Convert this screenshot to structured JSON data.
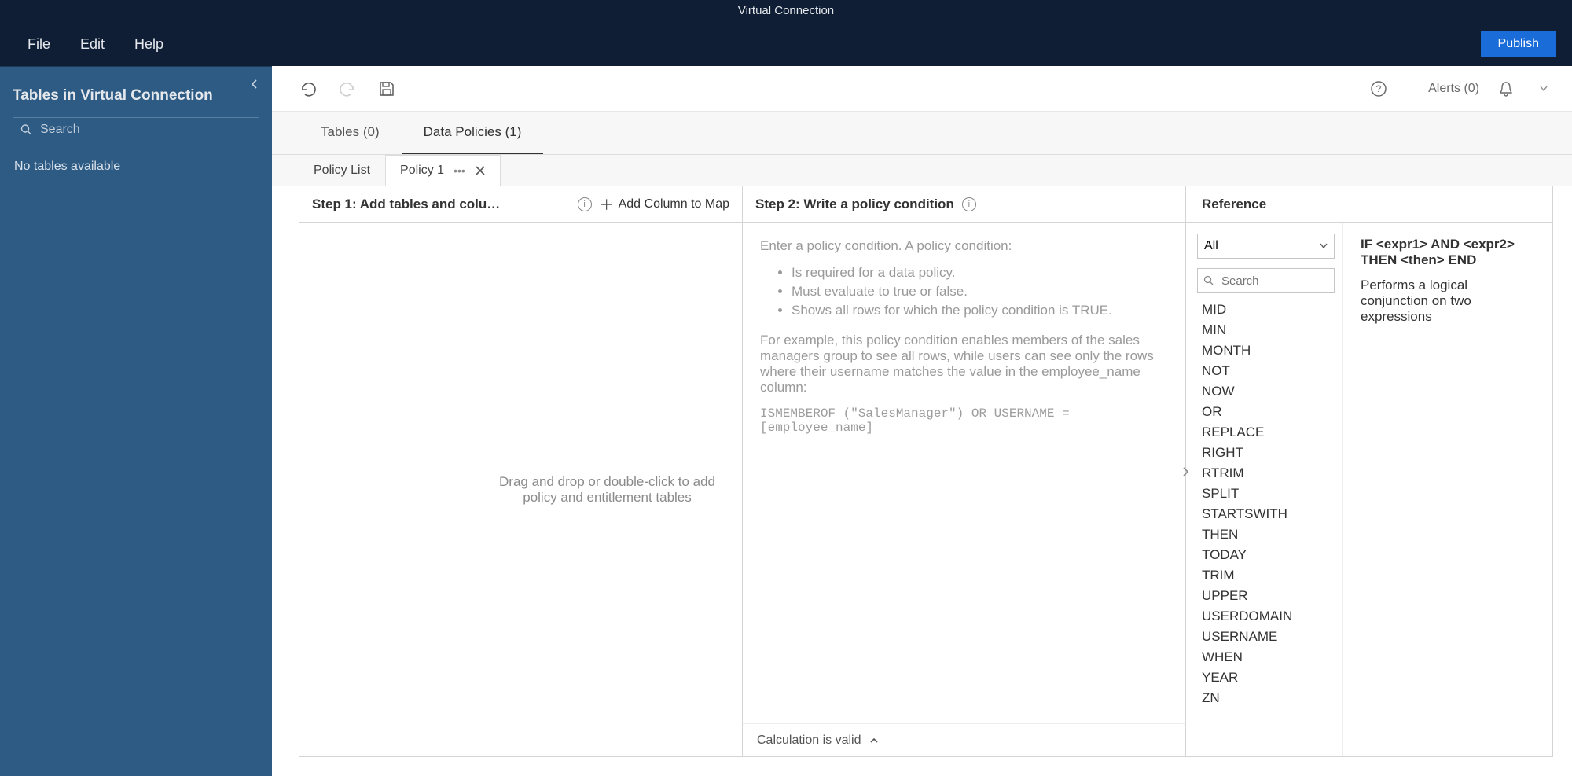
{
  "titlebar": "Virtual Connection",
  "menu": {
    "file": "File",
    "edit": "Edit",
    "help": "Help"
  },
  "publish_label": "Publish",
  "sidebar": {
    "title": "Tables in Virtual Connection",
    "search_placeholder": "Search",
    "empty": "No tables available"
  },
  "alerts_label": "Alerts (0)",
  "main_tabs": {
    "tables": "Tables (0)",
    "policies": "Data Policies (1)"
  },
  "sub_tabs": {
    "policy_list": "Policy List",
    "policy1": "Policy 1"
  },
  "step1": {
    "title": "Step 1: Add tables and colu…",
    "add_col": "Add Column to Map",
    "drop_hint": "Drag and drop or double-click to add policy and entitlement tables"
  },
  "step2": {
    "title": "Step 2: Write a policy condition",
    "hint_intro": "Enter a policy condition. A policy condition:",
    "bullets": [
      "Is required for a data policy.",
      "Must evaluate to true or false.",
      "Shows all rows for which the policy condition is TRUE."
    ],
    "example_text": "For example, this policy condition enables members of the sales managers group to see all rows, while users can see only the rows where their username matches the value in the employee_name column:",
    "code": "ISMEMBEROF (\"SalesManager\") OR USERNAME = [employee_name]",
    "footer": "Calculation is valid"
  },
  "reference": {
    "title": "Reference",
    "select_value": "All",
    "search_placeholder": "Search",
    "functions": [
      "MID",
      "MIN",
      "MONTH",
      "NOT",
      "NOW",
      "OR",
      "REPLACE",
      "RIGHT",
      "RTRIM",
      "SPLIT",
      "STARTSWITH",
      "THEN",
      "TODAY",
      "TRIM",
      "UPPER",
      "USERDOMAIN",
      "USERNAME",
      "WHEN",
      "YEAR",
      "ZN"
    ],
    "syntax": "IF <expr1> AND <expr2> THEN <then> END",
    "description": "Performs a logical conjunction on two expressions"
  }
}
